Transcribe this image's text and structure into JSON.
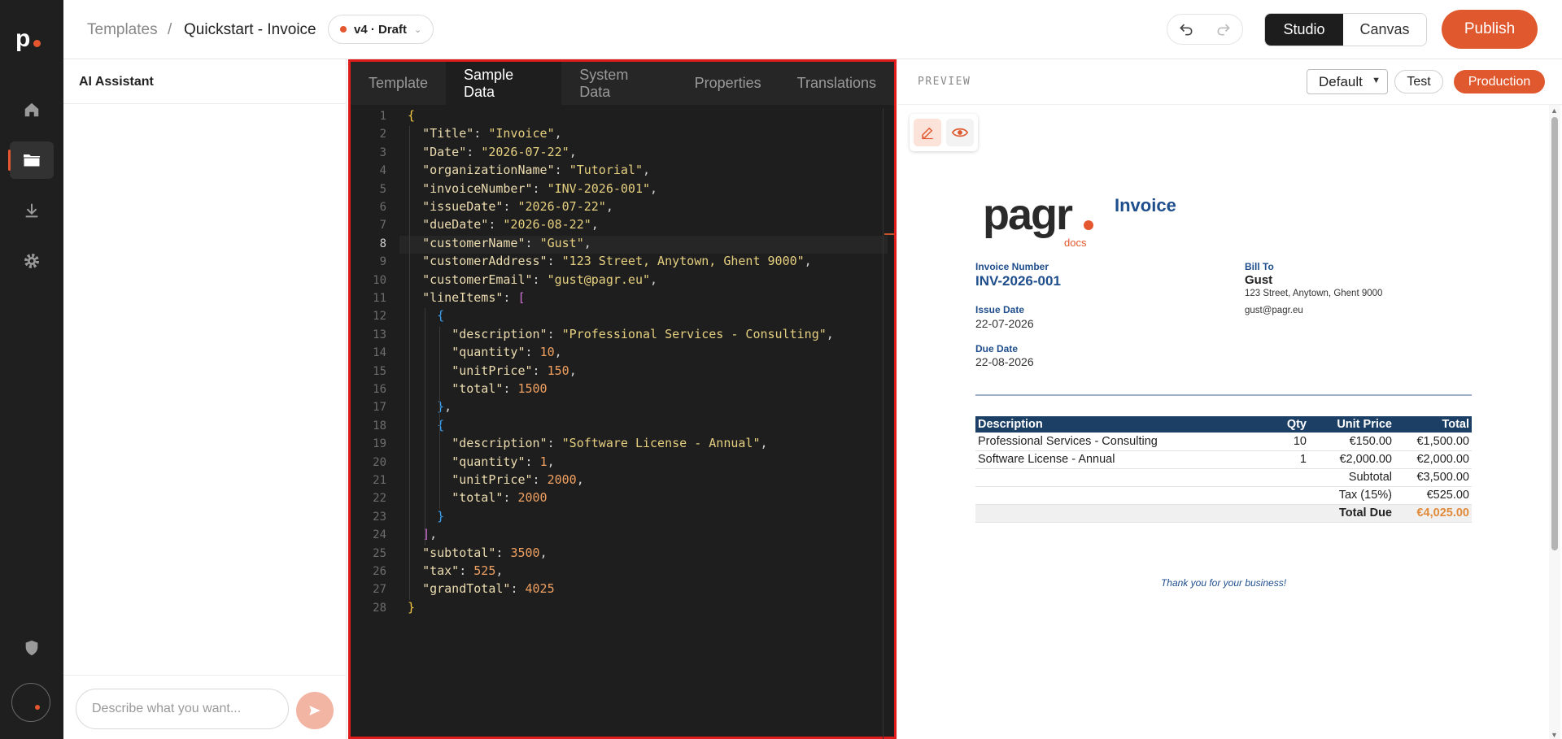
{
  "topbar": {
    "breadcrumb_root": "Templates",
    "breadcrumb_sep": "/",
    "breadcrumb_current": "Quickstart - Invoice",
    "version": "v4 · Draft",
    "studio": "Studio",
    "canvas": "Canvas",
    "publish": "Publish"
  },
  "ai": {
    "title": "AI Assistant",
    "input_placeholder": "Describe what you want..."
  },
  "editor": {
    "tabs": [
      "Template",
      "Sample Data",
      "System Data",
      "Properties",
      "Translations"
    ],
    "active_tab": "Sample Data",
    "current_line": 8,
    "lines": [
      "{",
      "  \"Title\": \"Invoice\",",
      "  \"Date\": \"2026-07-22\",",
      "  \"organizationName\": \"Tutorial\",",
      "  \"invoiceNumber\": \"INV-2026-001\",",
      "  \"issueDate\": \"2026-07-22\",",
      "  \"dueDate\": \"2026-08-22\",",
      "  \"customerName\": \"Gust\",",
      "  \"customerAddress\": \"123 Street, Anytown, Ghent 9000\",",
      "  \"customerEmail\": \"gust@pagr.eu\",",
      "  \"lineItems\": [",
      "    {",
      "      \"description\": \"Professional Services - Consulting\",",
      "      \"quantity\": 10,",
      "      \"unitPrice\": 150,",
      "      \"total\": 1500",
      "    },",
      "    {",
      "      \"description\": \"Software License - Annual\",",
      "      \"quantity\": 1,",
      "      \"unitPrice\": 2000,",
      "      \"total\": 2000",
      "    }",
      "  ],",
      "  \"subtotal\": 3500,",
      "  \"tax\": 525,",
      "  \"grandTotal\": 4025",
      "}"
    ]
  },
  "preview": {
    "label": "PREVIEW",
    "environment": "Default",
    "test": "Test",
    "production": "Production",
    "doc": {
      "logo_text": "pagr",
      "logo_sub": "docs",
      "title": "Invoice",
      "invoice_number_label": "Invoice Number",
      "invoice_number": "INV-2026-001",
      "issue_date_label": "Issue Date",
      "issue_date": "22-07-2026",
      "due_date_label": "Due Date",
      "due_date": "22-08-2026",
      "bill_to_label": "Bill To",
      "customer_name": "Gust",
      "customer_address": "123 Street, Anytown, Ghent 9000",
      "customer_email": "gust@pagr.eu",
      "table_headers": [
        "Description",
        "Qty",
        "Unit Price",
        "Total"
      ],
      "rows": [
        {
          "description": "Professional Services - Consulting",
          "qty": "10",
          "unit_price": "€150.00",
          "total": "€1,500.00"
        },
        {
          "description": "Software License - Annual",
          "qty": "1",
          "unit_price": "€2,000.00",
          "total": "€2,000.00"
        }
      ],
      "subtotal_label": "Subtotal",
      "subtotal": "€3,500.00",
      "tax_label": "Tax (15%)",
      "tax": "€525.00",
      "total_due_label": "Total Due",
      "total_due": "€4,025.00",
      "thanks": "Thank you for your business!"
    }
  },
  "colors": {
    "accent": "#e4572e",
    "selection": "#e01b1b",
    "invoice_blue": "#1f4e8c",
    "table_header": "#1c3f66"
  },
  "icons": [
    "home-icon",
    "folder-icon",
    "download-icon",
    "gear-icon",
    "shield-icon",
    "undo-icon",
    "redo-icon",
    "edit-icon",
    "eye-icon",
    "send-icon"
  ]
}
